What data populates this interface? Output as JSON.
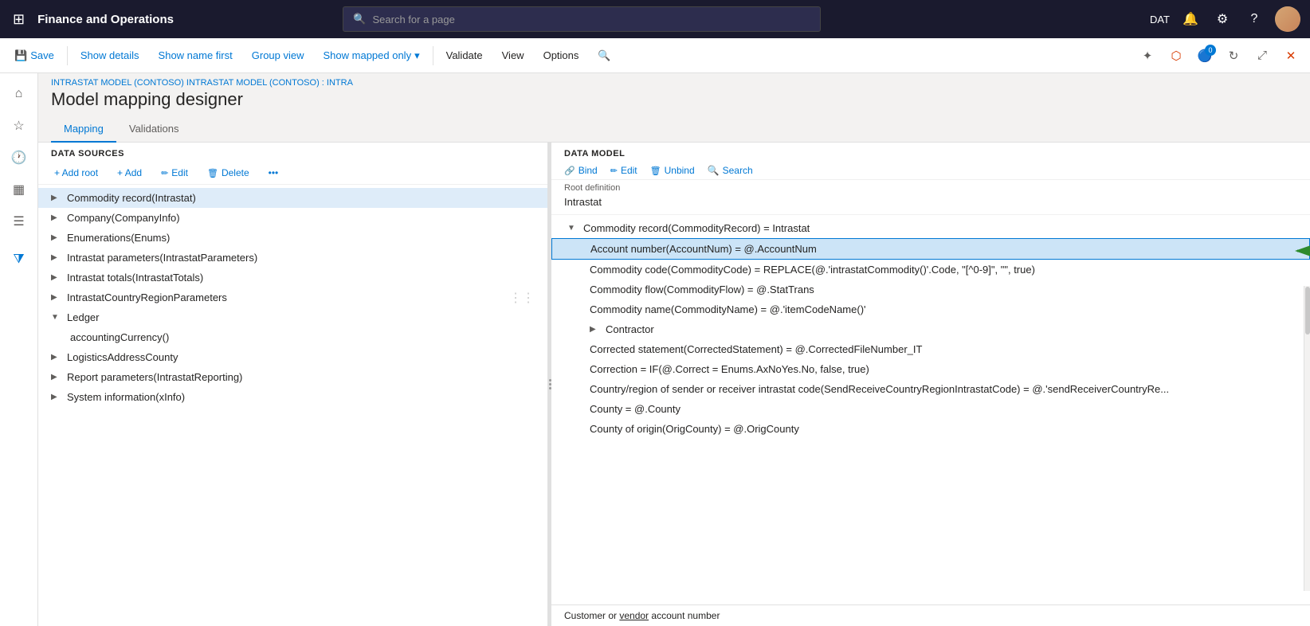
{
  "app": {
    "title": "Finance and Operations",
    "tenant": "DAT"
  },
  "topnav": {
    "search_placeholder": "Search for a page",
    "icons": [
      "🔔",
      "⚙",
      "?"
    ]
  },
  "toolbar": {
    "save": "Save",
    "show_details": "Show details",
    "show_name_first": "Show name first",
    "group_view": "Group view",
    "show_mapped_only": "Show mapped only",
    "validate": "Validate",
    "view": "View",
    "options": "Options"
  },
  "breadcrumb": "INTRASTAT MODEL (CONTOSO) INTRASTAT MODEL (CONTOSO) : INTRA",
  "page_title": "Model mapping designer",
  "tabs": [
    "Mapping",
    "Validations"
  ],
  "left_pane": {
    "header": "DATA SOURCES",
    "add_root": "+ Add root",
    "add": "+ Add",
    "edit": "Edit",
    "delete": "Delete",
    "items": [
      {
        "label": "Commodity record(Intrastat)",
        "level": 0,
        "expanded": false,
        "selected": true
      },
      {
        "label": "Company(CompanyInfo)",
        "level": 0,
        "expanded": false
      },
      {
        "label": "Enumerations(Enums)",
        "level": 0,
        "expanded": false
      },
      {
        "label": "Intrastat parameters(IntrastatParameters)",
        "level": 0,
        "expanded": false
      },
      {
        "label": "Intrastat totals(IntrastatTotals)",
        "level": 0,
        "expanded": false
      },
      {
        "label": "IntrastatCountryRegionParameters",
        "level": 0,
        "expanded": false
      },
      {
        "label": "Ledger",
        "level": 0,
        "expanded": true,
        "is_group": true
      },
      {
        "label": "accountingCurrency()",
        "level": 1
      },
      {
        "label": "LogisticsAddressCounty",
        "level": 0,
        "expanded": false
      },
      {
        "label": "Report parameters(IntrastatReporting)",
        "level": 0,
        "expanded": false
      },
      {
        "label": "System information(xInfo)",
        "level": 0,
        "expanded": false
      }
    ]
  },
  "right_pane": {
    "header": "DATA MODEL",
    "bind": "Bind",
    "edit": "Edit",
    "unbind": "Unbind",
    "search": "Search",
    "root_definition_label": "Root definition",
    "root_definition_value": "Intrastat",
    "items": [
      {
        "label": "Commodity record(CommodityRecord) = Intrastat",
        "level": 1,
        "expanded": true,
        "bold": false
      },
      {
        "label": "Account number(AccountNum) = @.AccountNum",
        "level": 2,
        "selected": true
      },
      {
        "label": "Commodity code(CommodityCode) = REPLACE(@.'intrastatCommodity()'.Code, \"[^0-9]\", \"\", true)",
        "level": 2
      },
      {
        "label": "Commodity flow(CommodityFlow) = @.StatTrans",
        "level": 2
      },
      {
        "label": "Commodity name(CommodityName) = @.'itemCodeName()'",
        "level": 2
      },
      {
        "label": "Contractor",
        "level": 2,
        "expanded": false
      },
      {
        "label": "Corrected statement(CorrectedStatement) = @.CorrectedFileNumber_IT",
        "level": 2
      },
      {
        "label": "Correction = IF(@.Correct = Enums.AxNoYes.No, false, true)",
        "level": 2
      },
      {
        "label": "Country/region of sender or receiver intrastat code(SendReceiveCountryRegionIntrastatCode) = @.'sendReceiverCountryRe...",
        "level": 2
      },
      {
        "label": "County = @.County",
        "level": 2
      },
      {
        "label": "County of origin(OrigCounty) = @.OrigCounty",
        "level": 2
      }
    ]
  },
  "bottom_tooltip": "Customer or vendor account number",
  "scrollbar_label": ""
}
